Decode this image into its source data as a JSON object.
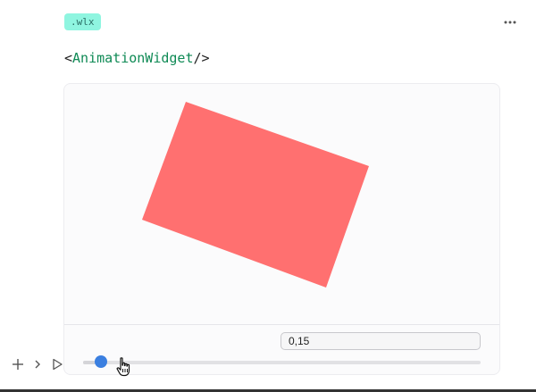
{
  "cell": {
    "language_badge": ".wlx",
    "code": {
      "open": "<",
      "tag": "AnimationWidget",
      "close": "/>"
    }
  },
  "widget": {
    "value_display": "0,15",
    "slider_value": 0.15,
    "shape_color": "#ff7070",
    "badge_color": "#8ff5e0",
    "thumb_color": "#3b7fe0"
  },
  "icons": {
    "more": "more-horizontal-icon",
    "add": "plus-icon",
    "expand": "chevron-right-icon",
    "run": "play-icon",
    "cursor": "hand-pointer-icon"
  }
}
